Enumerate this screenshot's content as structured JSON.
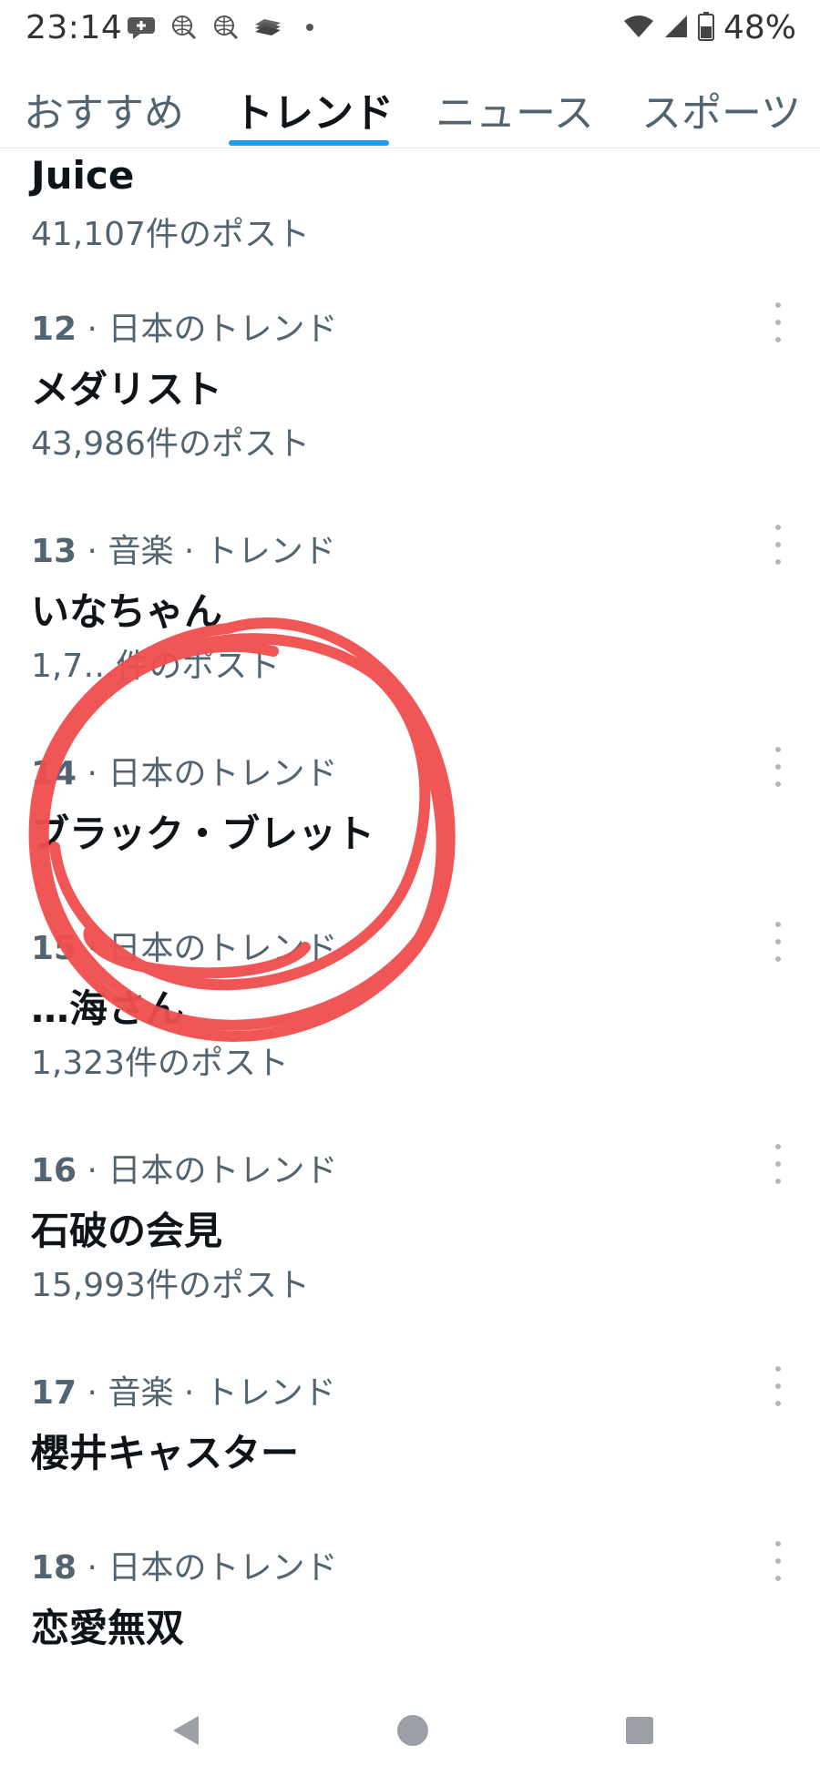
{
  "status_bar": {
    "time": "23:14",
    "battery": "48%",
    "icons_left": [
      "chat-plus-icon",
      "globe-search-icon",
      "globe-search-icon",
      "stack-icon",
      "dot-icon"
    ],
    "icons_right": [
      "wifi-icon",
      "signal-icon",
      "battery-icon"
    ]
  },
  "tabs": [
    {
      "label": "おすすめ"
    },
    {
      "label": "トレンド"
    },
    {
      "label": "ニュース"
    },
    {
      "label": "スポーツ"
    }
  ],
  "active_tab": "トレンド",
  "trends": [
    {
      "title": "Juice",
      "posts": "41,107件のポスト"
    },
    {
      "rank": "12",
      "category": " · 日本のトレンド",
      "title": "メダリスト",
      "posts": "43,986件のポスト"
    },
    {
      "rank": "13",
      "category": " · 音楽 · トレンド",
      "title": "いなちゃん",
      "posts": "1,7…件のポスト"
    },
    {
      "rank": "14",
      "category": " · 日本のトレンド",
      "title": "ブラック・ブレット"
    },
    {
      "rank": "15",
      "category": " · 日本のトレンド",
      "title": "…海さん",
      "posts": "1,323件のポスト"
    },
    {
      "rank": "16",
      "category": " · 日本のトレンド",
      "title": "石破の会見",
      "posts": "15,993件のポスト"
    },
    {
      "rank": "17",
      "category": " · 音楽 · トレンド",
      "title": "櫻井キャスター"
    },
    {
      "rank": "18",
      "category": " · 日本のトレンド",
      "title": "恋愛無双"
    }
  ],
  "annotation": {
    "type": "hand-drawn circle",
    "color": "#f04e4e"
  },
  "nav": [
    "back-icon",
    "home-icon",
    "recents-icon"
  ]
}
